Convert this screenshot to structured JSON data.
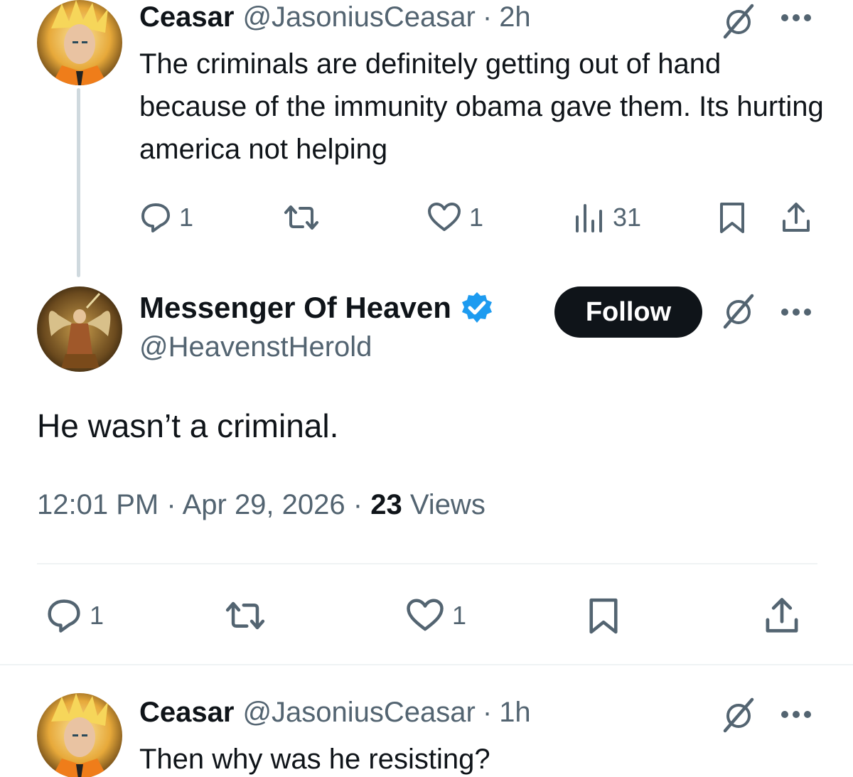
{
  "reply_1": {
    "display_name": "Ceasar",
    "handle": "@JasoniusCeasar",
    "separator": "·",
    "time": "2h",
    "text": "The criminals are definitely getting out of hand because of the immunity obama gave them. Its hurting america not helping",
    "actions": {
      "reply_count": "1",
      "repost_count": "",
      "like_count": "1",
      "views_count": "31"
    }
  },
  "main_tweet": {
    "display_name": "Messenger Of Heaven",
    "handle": "@HeavenstHerold",
    "follow_label": "Follow",
    "text": "He wasn’t a criminal.",
    "timestamp": "12:01 PM",
    "separator": "·",
    "date": "Apr 29, 2026",
    "views_count": "23",
    "views_label": "Views",
    "actions": {
      "reply_count": "1",
      "like_count": "1"
    }
  },
  "reply_2": {
    "display_name": "Ceasar",
    "handle": "@JasoniusCeasar",
    "separator": "·",
    "time": "1h",
    "text": "Then why was he resisting?"
  },
  "colors": {
    "text_primary": "#0f1419",
    "text_secondary": "#536471",
    "verified_blue": "#1d9bf0",
    "divider": "#eff3f4",
    "thread_line": "#cfd9de"
  },
  "icons": [
    "grok-icon",
    "more-icon",
    "reply-icon",
    "repost-icon",
    "like-icon",
    "views-icon",
    "bookmark-icon",
    "share-icon",
    "verified-badge-icon"
  ]
}
